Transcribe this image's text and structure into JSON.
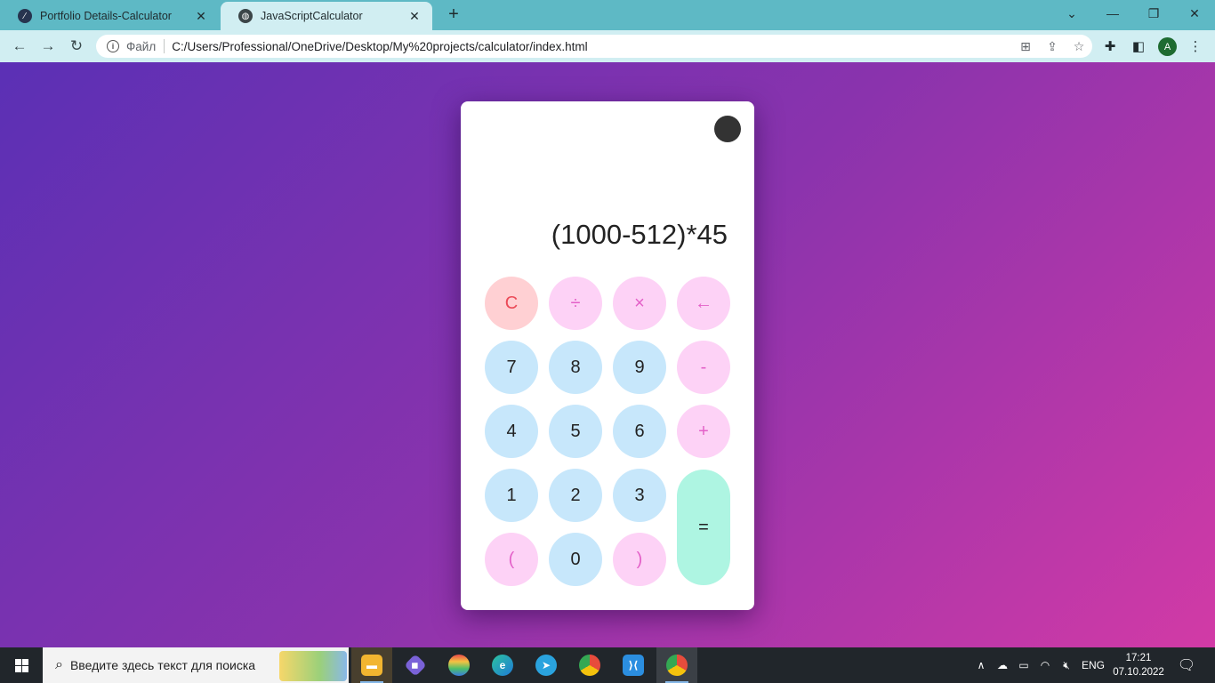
{
  "browser": {
    "tabs": [
      {
        "title": "Portfolio Details-Calculator",
        "favicon": "site-icon",
        "active": false
      },
      {
        "title": "JavaScriptCalculator",
        "favicon": "globe-icon",
        "active": true
      }
    ],
    "new_tab_label": "+",
    "address": {
      "scheme_label": "Файл",
      "url": "C:/Users/Professional/OneDrive/Desktop/My%20projects/calculator/index.html"
    },
    "profile_initial": "A"
  },
  "calculator": {
    "display": "(1000-512)*45",
    "keys": {
      "clear": "C",
      "divide": "÷",
      "multiply": "×",
      "backspace": "←",
      "seven": "7",
      "eight": "8",
      "nine": "9",
      "minus": "-",
      "four": "4",
      "five": "5",
      "six": "6",
      "plus": "+",
      "one": "1",
      "two": "2",
      "three": "3",
      "equals": "=",
      "open_paren": "(",
      "zero": "0",
      "close_paren": ")"
    },
    "colors": {
      "number_key": "#c7e7fb",
      "operator_key": "#fdd2f6",
      "clear_key": "#ffd0d3",
      "equals_key": "#aef5e2",
      "theme_toggle": "#333333"
    }
  },
  "taskbar": {
    "search_placeholder": "Введите здесь текст для поиска",
    "language": "ENG",
    "time": "17:21",
    "date": "07.10.2022",
    "apps": [
      "file-explorer-icon",
      "git-icon",
      "app-icon",
      "edge-icon",
      "telegram-icon",
      "chrome-icon",
      "vscode-icon",
      "chrome-profile-icon"
    ]
  }
}
